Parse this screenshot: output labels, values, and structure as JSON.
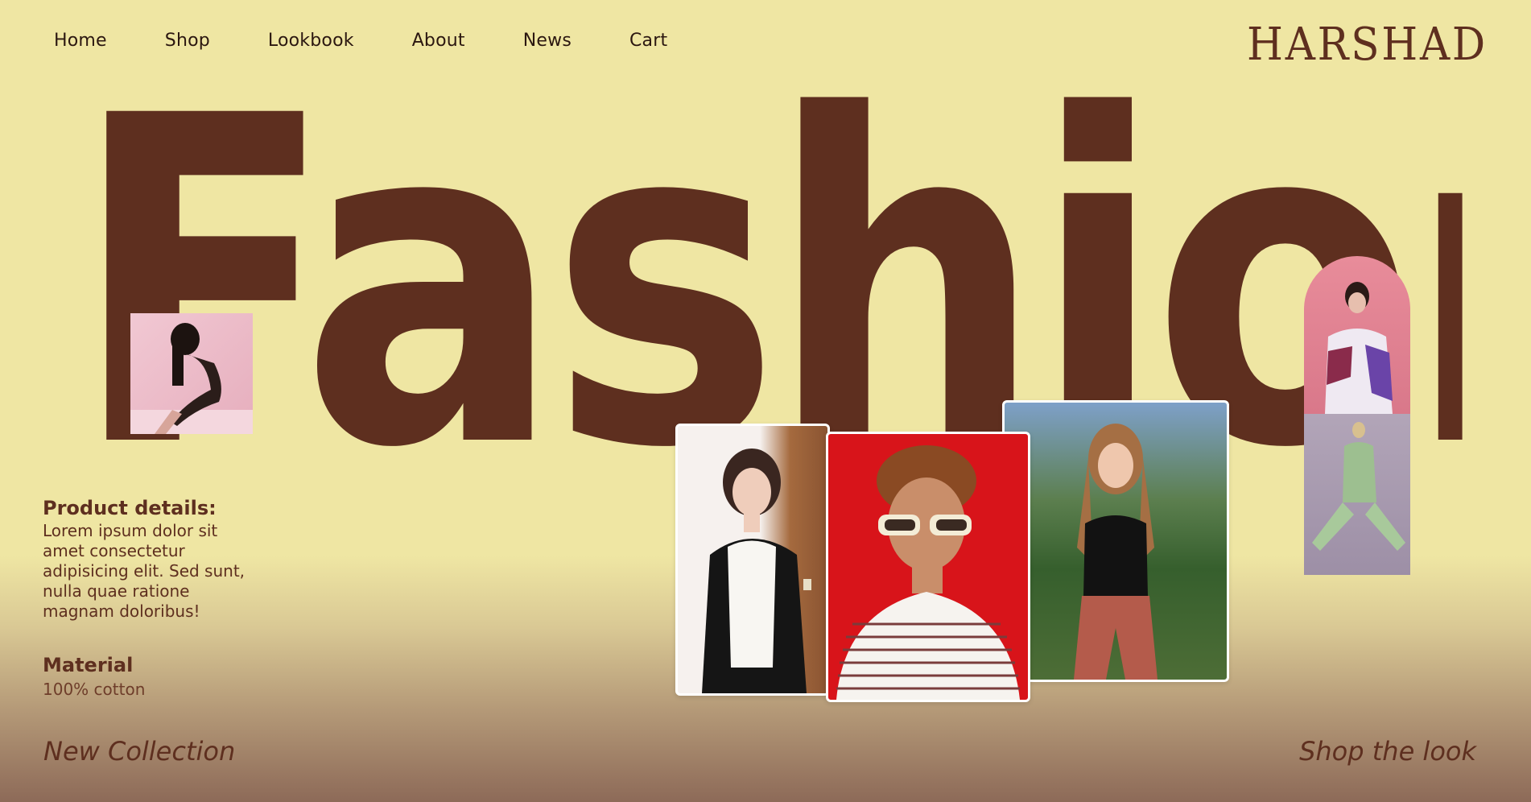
{
  "nav": {
    "items": [
      {
        "label": "Home"
      },
      {
        "label": "Shop"
      },
      {
        "label": "Lookbook"
      },
      {
        "label": "About"
      },
      {
        "label": "News"
      },
      {
        "label": "Cart"
      }
    ]
  },
  "brand": {
    "logo_text": "HARSHAD"
  },
  "hero": {
    "headline": "Fashion"
  },
  "product": {
    "details_title": "Product details:",
    "details_text": "Lorem ipsum dolor sit amet consectetur adipisicing elit. Sed sunt, nulla quae ratione magnam doloribus!",
    "material_title": "Material",
    "material_value": "100% cotton"
  },
  "footer": {
    "left_label": "New Collection",
    "right_label": "Shop the look"
  },
  "colors": {
    "background": "#efe6a3",
    "brand_brown": "#5e2f1f",
    "nav_text": "#2b1710"
  },
  "photos": [
    {
      "name": "photo-model-kneeling"
    },
    {
      "name": "photo-model-jacket-arch"
    },
    {
      "name": "photo-model-sitting"
    },
    {
      "name": "photo-model-blazer"
    },
    {
      "name": "photo-model-sunglasses"
    },
    {
      "name": "photo-model-outdoor"
    }
  ]
}
